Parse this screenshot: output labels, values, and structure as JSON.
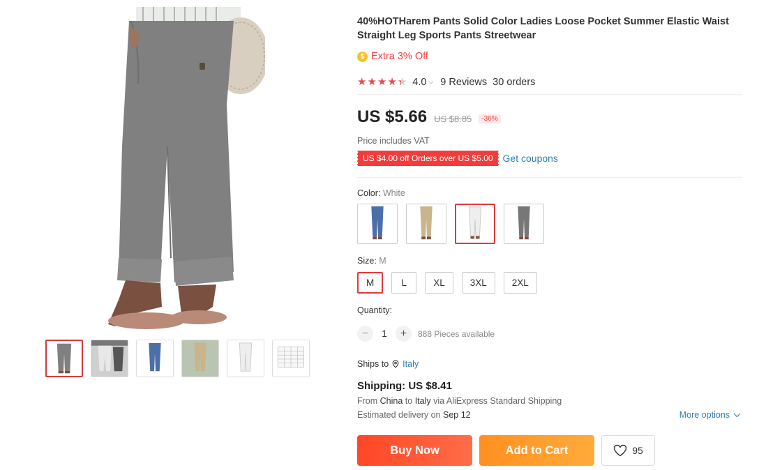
{
  "product": {
    "title": "40%HOTHarem Pants Solid Color Ladies Loose Pocket Summer Elastic Waist Straight Leg Sports Pants Streetwear",
    "extra_off": "Extra 3% Off",
    "rating": "4.0",
    "reviews": "9 Reviews",
    "orders": "30 orders",
    "price": "US $5.66",
    "old_price": "US $8.85",
    "discount": "-36%",
    "vat_note": "Price includes VAT",
    "coupon": "US $4.00 off Orders over US $5.00",
    "get_coupons": "Get coupons"
  },
  "gallery": {
    "main_color": "#808080",
    "thumb_colors": [
      "#808080",
      "#e8e8e8",
      "#4b6fa8",
      "#c9b48c",
      "#eeeeee",
      "#f8f8f8"
    ]
  },
  "color": {
    "label": "Color: ",
    "selected": "White",
    "swatches": [
      "#4b6fa8",
      "#c9b48c",
      "#eeeeee",
      "#777777"
    ]
  },
  "size": {
    "label": "Size: ",
    "selected": "M",
    "options": [
      "M",
      "L",
      "XL",
      "3XL",
      "2XL"
    ]
  },
  "quantity": {
    "label": "Quantity:",
    "minus": "−",
    "value": "1",
    "plus": "+",
    "available": "888 Pieces available"
  },
  "shipping": {
    "ships_to_label": "Ships to",
    "destination": "Italy",
    "headline": "Shipping: US $8.41",
    "from_prefix": "From ",
    "from_country": "China",
    "to_word": " to ",
    "to_country": "Italy",
    "via": " via AliExpress Standard Shipping",
    "est_prefix": "Estimated delivery on ",
    "est_date": "Sep 12",
    "more_options": "More options"
  },
  "actions": {
    "buy_now": "Buy Now",
    "add_to_cart": "Add to Cart",
    "wishlist_count": "95"
  },
  "colors": {
    "price_red": "#f13f3f",
    "link_blue": "#2e7fb0",
    "buy_orange": "#ff4626",
    "cart_orange": "#ff9020"
  }
}
